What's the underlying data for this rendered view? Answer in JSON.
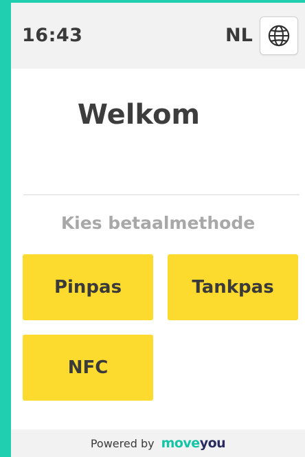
{
  "status_bar": {
    "time": "16:43",
    "language": "NL",
    "language_icon": "globe-icon"
  },
  "main": {
    "title": "Welkom",
    "subtitle": "Kies betaalmethode",
    "payment_methods": [
      {
        "label": "Pinpas"
      },
      {
        "label": "Tankpas"
      },
      {
        "label": "NFC"
      }
    ]
  },
  "footer": {
    "powered_by": "Powered by",
    "brand_part1": "move",
    "brand_part2": "you"
  },
  "colors": {
    "accent_teal": "#1fcfb0",
    "button_yellow": "#fcdb2e",
    "text_dark": "#3a3a3a",
    "text_muted": "#a8a8a8",
    "brand_navy": "#2a2b5e"
  }
}
